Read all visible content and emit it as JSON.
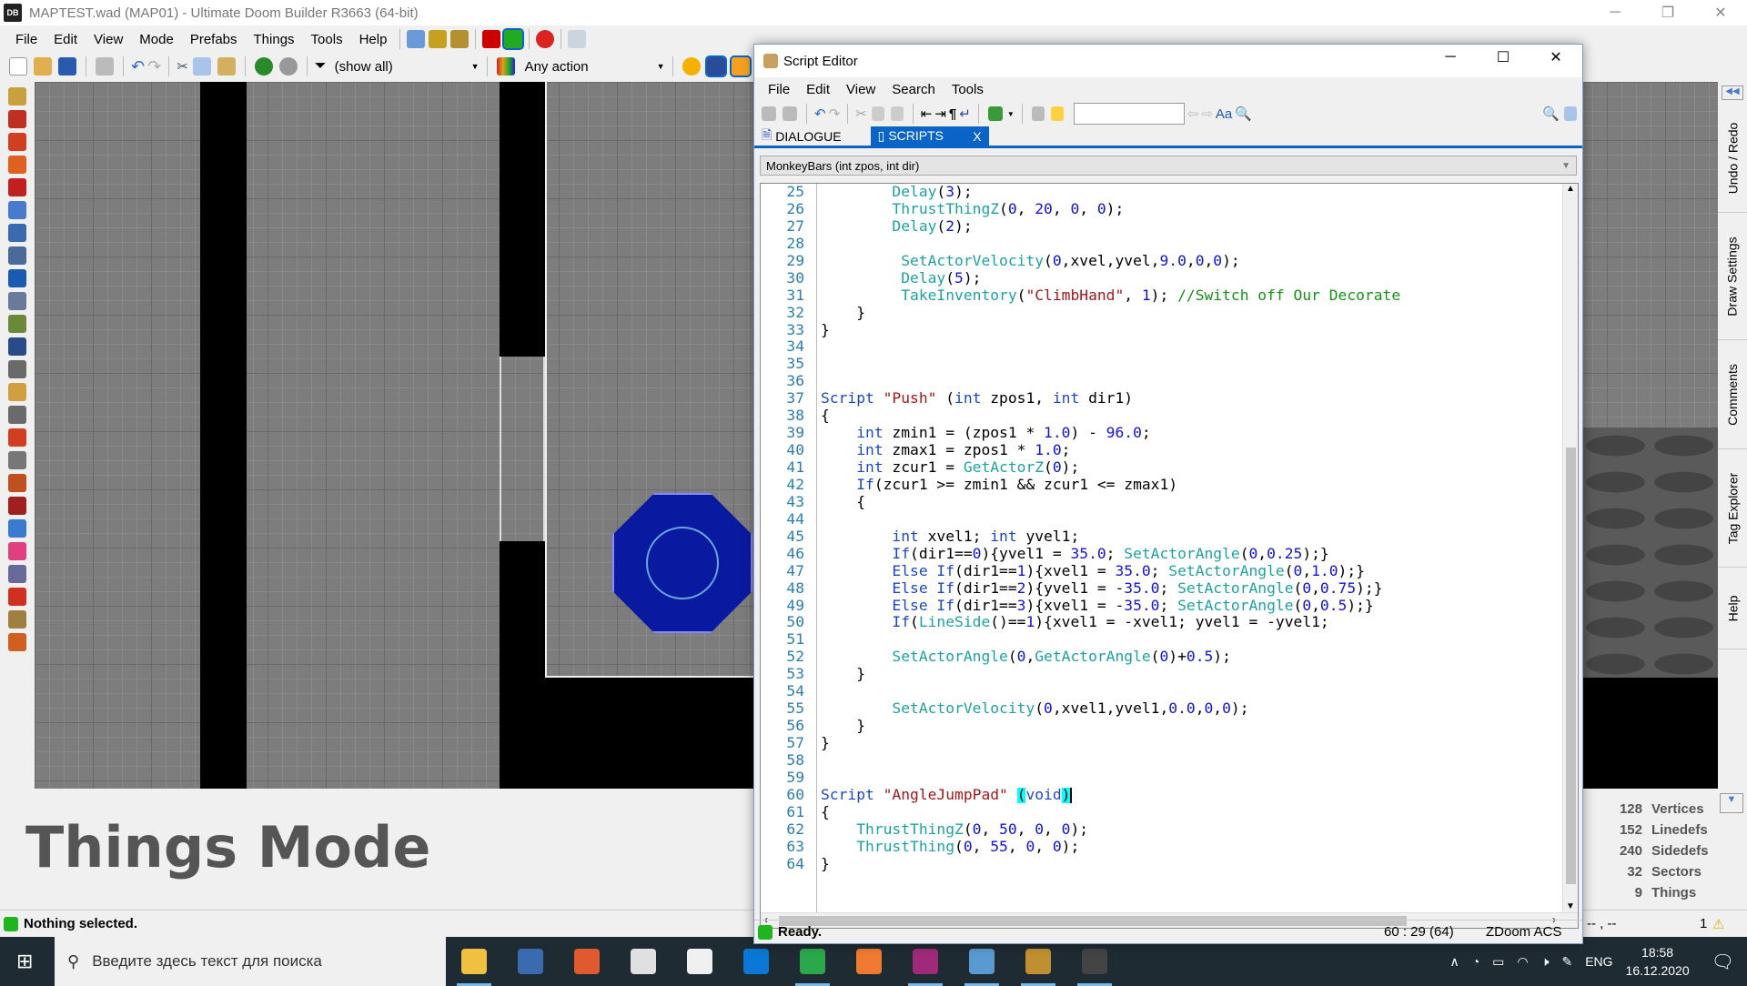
{
  "app": {
    "title": "MAPTEST.wad (MAP01) - Ultimate Doom Builder R3663 (64-bit)",
    "logo": "DB"
  },
  "menu": [
    "File",
    "Edit",
    "View",
    "Mode",
    "Prefabs",
    "Things",
    "Tools",
    "Help"
  ],
  "toolbar": {
    "filter": "(show all)",
    "action": "Any action"
  },
  "side_tabs": [
    "Undo / Redo",
    "Draw Settings",
    "Comments",
    "Tag Explorer",
    "Help"
  ],
  "info": {
    "mode": "Things Mode",
    "stats": [
      {
        "n": "128",
        "label": "Vertices"
      },
      {
        "n": "152",
        "label": "Linedefs"
      },
      {
        "n": "240",
        "label": "Sidedefs"
      },
      {
        "n": "32",
        "label": "Sectors"
      },
      {
        "n": "9",
        "label": "Things"
      }
    ],
    "coords": "-- , --",
    "warnings": "1"
  },
  "status": {
    "text": "Nothing selected.",
    "color": "#1fb51f"
  },
  "taskbar": {
    "search_placeholder": "Введите здесь текст для поиска",
    "lang": "ENG",
    "time": "18:58",
    "date": "16.12.2020"
  },
  "script_editor": {
    "title": "Script Editor",
    "menu": [
      "File",
      "Edit",
      "View",
      "Search",
      "Tools"
    ],
    "tabs": [
      {
        "label": "DIALOGUE",
        "active": false
      },
      {
        "label": "SCRIPTS",
        "active": true,
        "close": "X"
      }
    ],
    "script_select": "MonkeyBars (int zpos, int dir)",
    "first_line": 25,
    "code": [
      "        Delay(3);",
      "        ThrustThingZ(0, 20, 0, 0);",
      "        Delay(2);",
      "",
      "         SetActorVelocity(0,xvel,yvel,9.0,0,0);",
      "         Delay(5);",
      "         TakeInventory(\"ClimbHand\", 1); //Switch off Our Decorate",
      "    }",
      "}",
      "",
      "",
      "",
      "Script \"Push\" (int zpos1, int dir1)",
      "{",
      "    int zmin1 = (zpos1 * 1.0) - 96.0;",
      "    int zmax1 = zpos1 * 1.0;",
      "    int zcur1 = GetActorZ(0);",
      "    If(zcur1 >= zmin1 && zcur1 <= zmax1)",
      "    {",
      "",
      "        int xvel1; int yvel1;",
      "        If(dir1==0){yvel1 = 35.0; SetActorAngle(0,0.25);}",
      "        Else If(dir1==1){xvel1 = 35.0; SetActorAngle(0,1.0);}",
      "        Else If(dir1==2){yvel1 = -35.0; SetActorAngle(0,0.75);}",
      "        Else If(dir1==3){xvel1 = -35.0; SetActorAngle(0,0.5);}",
      "        If(LineSide()==1){xvel1 = -xvel1; yvel1 = -yvel1;",
      "",
      "        SetActorAngle(0,GetActorAngle(0)+0.5);",
      "    }",
      "",
      "        SetActorVelocity(0,xvel1,yvel1,0.0,0,0);",
      "    }",
      "}",
      "",
      "",
      "Script \"AngleJumpPad\" (void)",
      "{",
      "    ThrustThingZ(0, 50, 0, 0);",
      "    ThrustThing(0, 55, 0, 0);",
      "}"
    ],
    "status": "Ready.",
    "cursor": "60 : 29 (64)",
    "language": "ZDoom ACS"
  }
}
